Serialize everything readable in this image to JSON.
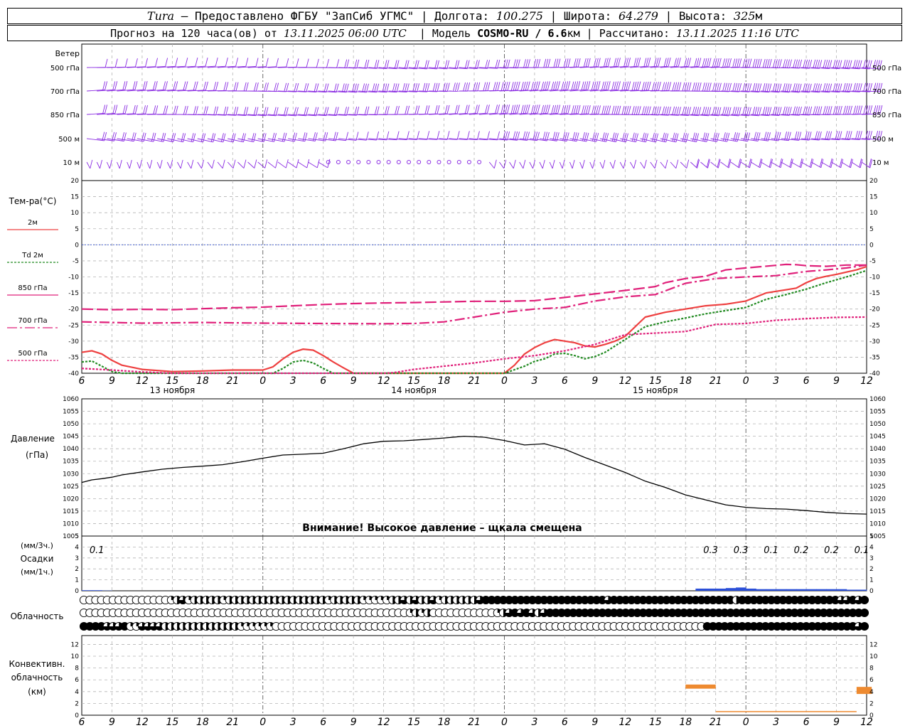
{
  "header": {
    "station": "Tura",
    "provider": " – Предоставлено ФГБУ \"ЗапСиб УГМС\" | ",
    "lon_label": "Долгота: ",
    "lon": "100.275",
    "lat_label": " | Широта: ",
    "lat": "64.279",
    "alt_label": " | Высота: ",
    "alt": "325",
    "alt_unit": "м",
    "forecast_text": "Прогноз на 120 часа(ов) от ",
    "run_time": "13.11.2025 06:00 UTC",
    "model_label": "  | Модель ",
    "model": "COSMO-RU / 6.6",
    "model_unit": "км",
    "computed_label": " | Рассчитано: ",
    "computed": "13.11.2025 11:16 UTC"
  },
  "wind_panel": {
    "title": "Ветер",
    "levels": [
      "500 гПа",
      "700 гПа",
      "850 гПа",
      "500 м",
      "10  м"
    ]
  },
  "temp_panel": {
    "title": "Тем-ра(°C)",
    "legend": [
      {
        "label": "2м",
        "color": "#ee4040",
        "style": "solid"
      },
      {
        "label": "Td 2м",
        "color": "#228b22",
        "style": "dotted"
      },
      {
        "label": "850 гПа",
        "color": "#e0207a",
        "style": "solid"
      },
      {
        "label": "700 гПа",
        "color": "#e0207a",
        "style": "dashdot"
      },
      {
        "label": "500 гПа",
        "color": "#e0207a",
        "style": "dotted"
      }
    ]
  },
  "pressure_panel": {
    "title": "Давление",
    "unit": "(гПа)",
    "warning": "Внимание! Высокое давление – щкала смещена"
  },
  "precip_panel": {
    "unit_3h": "(мм/3ч.)",
    "title": "Осадки",
    "unit_1h": "(мм/1ч.)",
    "totals": [
      {
        "label": "0.1",
        "t": 1.5
      },
      {
        "label": "0.3",
        "t": 62.5
      },
      {
        "label": "0.3",
        "t": 65.5
      },
      {
        "label": "0.1",
        "t": 68.5
      },
      {
        "label": "0.2",
        "t": 71.5
      },
      {
        "label": "0.2",
        "t": 74.5
      },
      {
        "label": "0.1",
        "t": 77.5
      }
    ]
  },
  "cloud_panel": {
    "title": "Облачность"
  },
  "conv_panel": {
    "title1": "Конвективн.",
    "title2": "облачность",
    "unit": "(км)"
  },
  "time_axis": {
    "hour_labels": [
      "6",
      "9",
      "12",
      "15",
      "18",
      "21",
      "0",
      "3",
      "6",
      "9",
      "12",
      "15",
      "18",
      "21",
      "0",
      "3",
      "6",
      "9",
      "12",
      "15",
      "18",
      "21",
      "0",
      "3",
      "6",
      "9",
      "12"
    ],
    "day_labels": [
      {
        "label": "13 ноября",
        "t": 9
      },
      {
        "label": "14 ноября",
        "t": 33
      },
      {
        "label": "15 ноября",
        "t": 57
      }
    ]
  },
  "chart_data": [
    {
      "type": "line",
      "title": "Тем-ра(°C)",
      "x_unit": "hours from 13.11 06 UTC",
      "ylim": [
        -40,
        20
      ],
      "y_ticks": [
        -40,
        -35,
        -30,
        -25,
        -20,
        -15,
        -10,
        -5,
        0,
        5,
        10,
        15,
        20
      ],
      "series": [
        {
          "name": "2м",
          "color": "#ee4040",
          "style": "solid",
          "x": [
            0,
            1,
            2,
            3,
            4,
            6,
            9,
            12,
            15,
            18,
            19,
            20,
            21,
            22,
            23,
            24,
            25,
            26,
            27,
            28,
            30,
            36,
            39,
            42,
            43,
            44,
            45,
            46,
            47,
            48,
            49,
            50,
            51,
            52,
            53,
            54,
            56,
            58,
            60,
            62,
            64,
            66,
            68,
            70,
            71,
            72,
            73,
            74,
            75,
            76,
            77,
            78
          ],
          "y": [
            -33.5,
            -33,
            -34,
            -36,
            -37.5,
            -38.8,
            -39.5,
            -39.3,
            -39,
            -39,
            -38,
            -35.5,
            -33.5,
            -32.5,
            -32.8,
            -34.5,
            -36.5,
            -38.3,
            -40,
            -40,
            -40,
            -40,
            -40,
            -40,
            -37.5,
            -34,
            -32,
            -30.5,
            -29.5,
            -30,
            -30.5,
            -31.5,
            -31.8,
            -31,
            -30,
            -28.5,
            -22.5,
            -21,
            -20,
            -19,
            -18.5,
            -17.5,
            -15,
            -14,
            -13.5,
            -11.8,
            -10.5,
            -9.8,
            -9.2,
            -8.5,
            -7.8,
            -6.8
          ]
        },
        {
          "name": "Td 2м",
          "color": "#228b22",
          "style": "dotted",
          "x": [
            0,
            1,
            2,
            3,
            4,
            6,
            9,
            12,
            15,
            18,
            19,
            20,
            21,
            22,
            23,
            24,
            25,
            26,
            27,
            28,
            30,
            36,
            42,
            44,
            45,
            46,
            47,
            48,
            49,
            50,
            51,
            52,
            53,
            54,
            56,
            58,
            60,
            62,
            64,
            66,
            68,
            70,
            72,
            74,
            76,
            78
          ],
          "y": [
            -36.5,
            -36.2,
            -37.8,
            -39.5,
            -40,
            -40,
            -40,
            -40,
            -40,
            -40,
            -40,
            -38.5,
            -36.5,
            -36,
            -36.8,
            -38.5,
            -40,
            -40,
            -40,
            -40,
            -40,
            -40,
            -40,
            -37.8,
            -36.3,
            -35.5,
            -34,
            -33.8,
            -34.5,
            -35.5,
            -34.8,
            -33.5,
            -31.5,
            -29.5,
            -25.5,
            -24,
            -22.8,
            -21.5,
            -20.5,
            -19.5,
            -17,
            -15.5,
            -13.8,
            -11.8,
            -10,
            -8
          ]
        },
        {
          "name": "850 гПа",
          "color": "#e0207a",
          "style": "dashed",
          "x": [
            0,
            3,
            6,
            9,
            12,
            15,
            18,
            21,
            24,
            27,
            30,
            33,
            36,
            39,
            42,
            45,
            48,
            51,
            54,
            57,
            58,
            60,
            62,
            63,
            64,
            66,
            69,
            70,
            71,
            72,
            74,
            76,
            78
          ],
          "y": [
            -20,
            -20.2,
            -20.1,
            -20.2,
            -19.9,
            -19.6,
            -19.4,
            -19,
            -18.6,
            -18.3,
            -18.1,
            -18,
            -17.8,
            -17.6,
            -17.6,
            -17.4,
            -16.4,
            -15.3,
            -14.2,
            -13,
            -11.8,
            -10.5,
            -9.8,
            -8.8,
            -7.8,
            -7.2,
            -6.4,
            -6.1,
            -6.2,
            -6.5,
            -6.7,
            -6.3,
            -6.3
          ]
        },
        {
          "name": "700 гПа",
          "color": "#e0207a",
          "style": "dashdot",
          "x": [
            0,
            6,
            12,
            18,
            24,
            30,
            33,
            36,
            39,
            42,
            45,
            48,
            51,
            54,
            57,
            60,
            63,
            66,
            69,
            72,
            74,
            76,
            78
          ],
          "y": [
            -24,
            -24.4,
            -24.2,
            -24.4,
            -24.5,
            -24.6,
            -24.5,
            -24,
            -22.5,
            -21,
            -20,
            -19.5,
            -17.5,
            -16.2,
            -15.5,
            -12,
            -10.5,
            -10,
            -9.6,
            -8.3,
            -7.8,
            -7.2,
            -6.3
          ]
        },
        {
          "name": "500 гПа",
          "color": "#e0207a",
          "style": "dotted",
          "x": [
            0,
            3,
            6,
            9,
            12,
            15,
            18,
            21,
            24,
            27,
            30,
            31,
            33,
            36,
            39,
            42,
            45,
            48,
            51,
            54,
            57,
            60,
            63,
            66,
            69,
            72,
            75,
            78
          ],
          "y": [
            -38.5,
            -39,
            -39.6,
            -40,
            -40,
            -40,
            -40,
            -40,
            -40,
            -40,
            -40,
            -39.8,
            -38.8,
            -37.8,
            -36.8,
            -35.5,
            -34.5,
            -33,
            -31,
            -28,
            -27.5,
            -27,
            -24.8,
            -24.5,
            -23.5,
            -23,
            -22.6,
            -22.5
          ]
        }
      ]
    },
    {
      "type": "line",
      "title": "Давление",
      "ylabel": "(гПа)",
      "ylim": [
        1005,
        1060
      ],
      "y_ticks": [
        1005,
        1010,
        1015,
        1020,
        1025,
        1030,
        1035,
        1040,
        1045,
        1050,
        1055,
        1060
      ],
      "series": [
        {
          "name": "Давление",
          "color": "#000000",
          "style": "solid",
          "x": [
            0,
            1,
            2,
            3,
            4,
            6,
            8,
            10,
            12,
            14,
            15,
            16,
            18,
            20,
            22,
            24,
            26,
            28,
            30,
            32,
            34,
            36,
            38,
            40,
            42,
            44,
            46,
            48,
            50,
            52,
            54,
            56,
            58,
            60,
            62,
            64,
            66,
            68,
            70,
            72,
            74,
            76,
            78
          ],
          "y": [
            1026.5,
            1027.5,
            1028,
            1028.6,
            1029.5,
            1030.7,
            1031.8,
            1032.5,
            1033,
            1033.6,
            1034.2,
            1034.8,
            1036.2,
            1037.5,
            1037.8,
            1038.2,
            1040,
            1042,
            1043,
            1043.2,
            1043.7,
            1044.3,
            1045,
            1044.6,
            1043.3,
            1041.5,
            1042,
            1039.8,
            1036.5,
            1033.5,
            1030.5,
            1027,
            1024.5,
            1021.5,
            1019.5,
            1017.5,
            1016.5,
            1016,
            1015.8,
            1015.2,
            1014.5,
            1014,
            1013.8
          ]
        }
      ]
    },
    {
      "type": "bar",
      "title": "Осадки",
      "ylabel": "(мм/1ч.)",
      "ylim": [
        0,
        5
      ],
      "y_ticks": [
        0,
        1,
        2,
        3,
        4,
        5
      ],
      "x": [
        1,
        2,
        3,
        62,
        63,
        64,
        65,
        66,
        67,
        68,
        69,
        70,
        71,
        72,
        73,
        74,
        75,
        76,
        77,
        78
      ],
      "values": [
        0.05,
        0.05,
        0.02,
        0.2,
        0.2,
        0.2,
        0.25,
        0.3,
        0.2,
        0.15,
        0.15,
        0.15,
        0.15,
        0.15,
        0.15,
        0.15,
        0.15,
        0.15,
        0.1,
        0.1
      ],
      "color": "#2b4fd8"
    },
    {
      "type": "bar",
      "title": "Конвективн. облачность",
      "ylabel": "(км)",
      "ylim": [
        0,
        13
      ],
      "y_ticks": [
        0,
        2,
        4,
        6,
        8,
        10,
        12
      ],
      "segments": [
        {
          "x0": 60,
          "x1": 63,
          "bottom": 4.5,
          "top": 5.2,
          "color": "#ee8a30"
        },
        {
          "x0": 77,
          "x1": 78.5,
          "bottom": 3.6,
          "top": 4.8,
          "color": "#ee8a30"
        },
        {
          "x0": 63,
          "x1": 77,
          "bottom": 0.55,
          "top": 0.7,
          "color": "#ee8a30"
        }
      ]
    }
  ],
  "wind_levels_data": {
    "levels": [
      "500 гПа",
      "700 гПа",
      "850 гПа",
      "500 м",
      "10  м"
    ],
    "base_direction_deg": [
      270,
      270,
      270,
      250,
      200
    ],
    "speed_knots_by_segment": {
      "t0_24": [
        10,
        20,
        15,
        15,
        5
      ],
      "t24_40": [
        15,
        25,
        20,
        10,
        0
      ],
      "t40_60": [
        30,
        35,
        35,
        25,
        10
      ],
      "t60_78": [
        45,
        40,
        45,
        30,
        15
      ]
    }
  },
  "cloud_rows": {
    "upper": "000000000000000123122222122222222222222222122222111112232322312222223444444444444444444444344444444444444444444424444444444444444433434",
    "middle": "000000000000000000000000000000000000000000000000000000001212000000000001234343234444444444444444444444444444444444444444444444444444444",
    "lower": "444433341133332222222222222111111000000000000000000000000000000000000000000000000000000000000000000000000004444444444444444444444444434"
  }
}
